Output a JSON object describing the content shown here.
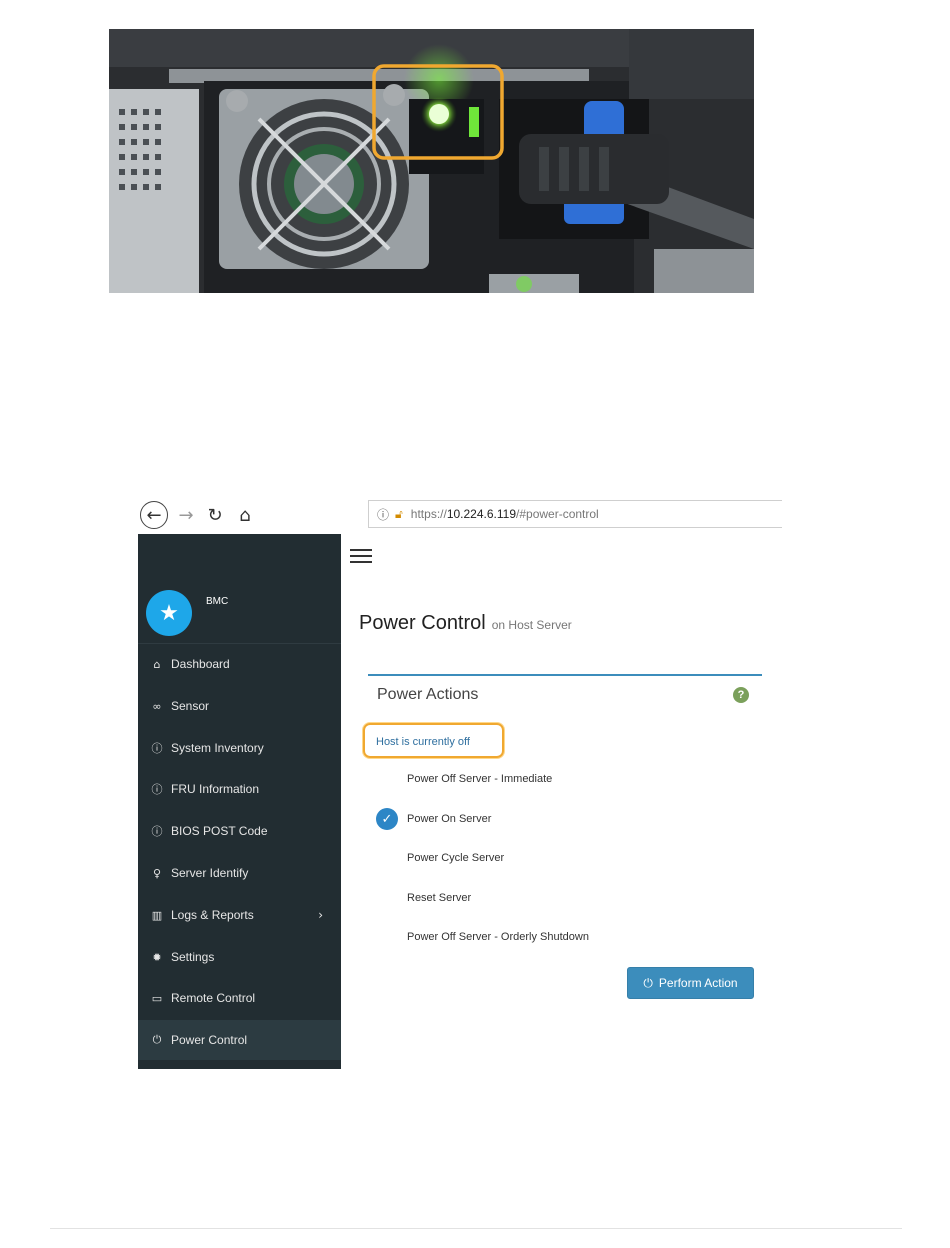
{
  "browser": {
    "url_protocol": "https://",
    "url_host": "10.224.6.119",
    "url_path": "/#power-control"
  },
  "sidebar": {
    "brand": "BMC",
    "items": [
      {
        "label": "Dashboard",
        "icon": "home-icon"
      },
      {
        "label": "Sensor",
        "icon": "binoculars-icon"
      },
      {
        "label": "System Inventory",
        "icon": "info-icon"
      },
      {
        "label": "FRU Information",
        "icon": "info-icon"
      },
      {
        "label": "BIOS POST Code",
        "icon": "info-icon"
      },
      {
        "label": "Server Identify",
        "icon": "lightbulb-icon"
      },
      {
        "label": "Logs & Reports",
        "icon": "bar-chart-icon"
      },
      {
        "label": "Settings",
        "icon": "gear-icon"
      },
      {
        "label": "Remote Control",
        "icon": "monitor-icon"
      },
      {
        "label": "Power Control",
        "icon": "power-icon"
      }
    ],
    "active_item": "Power Control"
  },
  "main": {
    "title": "Power Control",
    "subtitle": "on Host Server",
    "box_title": "Power Actions",
    "status": "Host is currently off",
    "options": [
      "Power Off Server - Immediate",
      "Power On Server",
      "Power Cycle Server",
      "Reset Server",
      "Power Off Server - Orderly Shutdown"
    ],
    "selected_option": "Power On Server",
    "action_button": "Perform Action"
  },
  "colors": {
    "sidebar_bg": "#222d32",
    "accent": "#3c8dbc",
    "highlight": "#f0a830",
    "led_green": "#7dff3a"
  }
}
